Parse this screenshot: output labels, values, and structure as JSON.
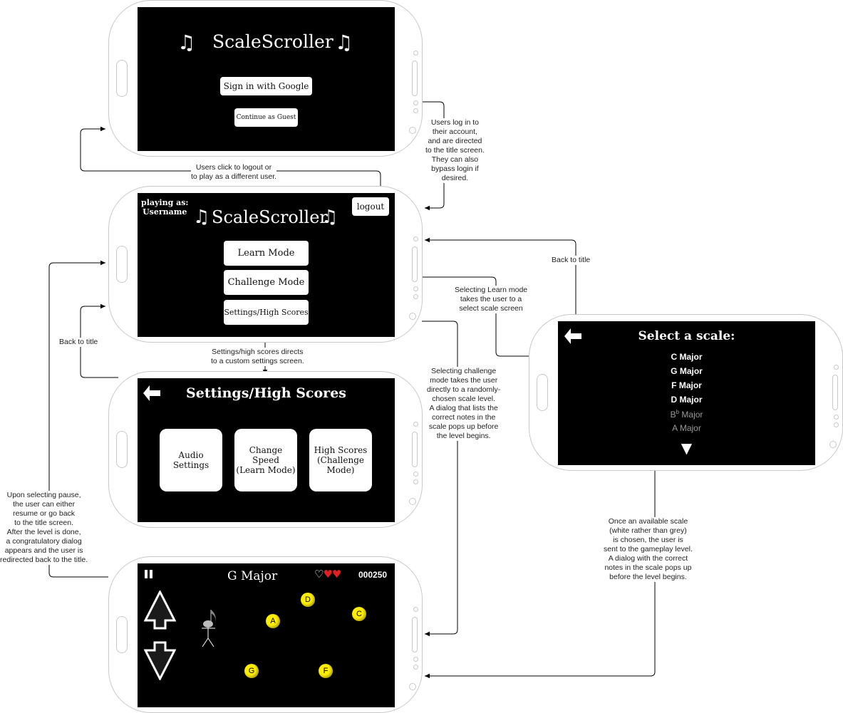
{
  "screens": {
    "login": {
      "title": "ScaleScroller",
      "note_icon": "♫",
      "sign_in_button": "Sign in with Google",
      "guest_button": "Continue as Guest"
    },
    "title": {
      "playing_as_label": "playing as:",
      "username": "Username",
      "logout_button": "logout",
      "title": "ScaleScroller",
      "note_icon": "♫",
      "learn_button": "Learn Mode",
      "challenge_button": "Challenge Mode",
      "settings_button": "Settings/High Scores"
    },
    "settings": {
      "back_icon": "🡐",
      "title": "Settings/High Scores",
      "audio_button": "Audio Settings",
      "speed_button_line1": "Change Speed",
      "speed_button_line2": "(Learn Mode)",
      "scores_button_line1": "High Scores",
      "scores_button_line2": "(Challenge",
      "scores_button_line3": "Mode)"
    },
    "select_scale": {
      "title": "Select a scale:",
      "scales": [
        {
          "label": "C Major",
          "available": true
        },
        {
          "label": "G Major",
          "available": true
        },
        {
          "label": "F Major",
          "available": true
        },
        {
          "label": "D Major",
          "available": true
        },
        {
          "label": "B",
          "sup": "b",
          "suffix": " Major",
          "available": false
        },
        {
          "label": "A Major",
          "available": false
        }
      ],
      "scroll_down_icon": "▼"
    },
    "gameplay": {
      "scale_title": "G Major",
      "score": "000250",
      "lives_total": 3,
      "lives_remaining": 2,
      "notes": [
        "D",
        "C",
        "A",
        "G",
        "F"
      ]
    }
  },
  "annotations": {
    "login_to_title": [
      "Users log in to",
      "their account,",
      "and are directed",
      "to the title screen.",
      "They can also",
      "bypass login if",
      "desired."
    ],
    "logout": [
      "Users click to logout or",
      "to play as a different user."
    ],
    "back_to_title_settings": "Back to title",
    "settings_directs": [
      "Settings/high scores directs",
      "to a custom settings screen."
    ],
    "back_to_title_scale": "Back to title",
    "learn_mode": [
      "Selecting Learn mode",
      "takes the user to a",
      "select scale screen"
    ],
    "challenge_mode": [
      "Selecting challenge",
      "mode takes the user",
      "directly to a randomly-",
      "chosen scale level.",
      "A dialog that lists the",
      "correct notes in the",
      "scale pops up before",
      "the level begins."
    ],
    "pause": [
      "Upon selecting pause,",
      "the user can either",
      "resume or go back",
      "to the title screen.",
      "After the level is done,",
      "a congratulatory dialog",
      "appears and the user is",
      "redirected back to the title."
    ],
    "scale_chosen": [
      "Once an available scale",
      "(white rather than grey)",
      "is chosen, the user is",
      "sent to the gameplay level.",
      "A dialog with the correct",
      "notes in the scale pops up",
      "before the level begins."
    ]
  },
  "colors": {
    "screen_bg": "#000000",
    "available_scale": "#ffffff",
    "unavailable_scale": "#9a9a9a",
    "note_ball": "#ffee00",
    "heart": "#e02020"
  }
}
